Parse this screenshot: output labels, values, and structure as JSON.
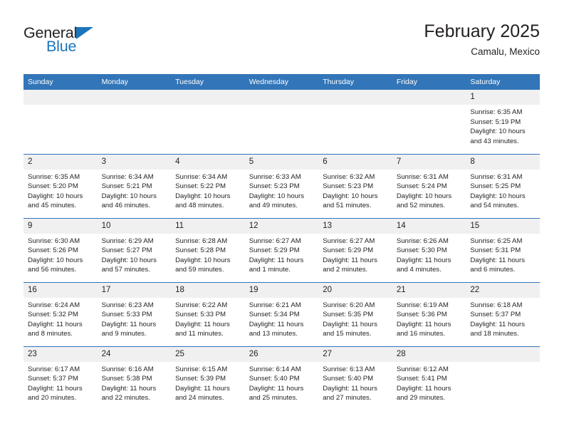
{
  "brand": {
    "name_part1": "General",
    "name_part2": "Blue",
    "triangle_icon": "triangle-icon",
    "accent_color": "#1b75bb"
  },
  "header": {
    "title": "February 2025",
    "subtitle": "Camalu, Mexico"
  },
  "colors": {
    "header_blue": "#3275b8",
    "daynum_band": "#f0f0f0",
    "text": "#231f20"
  },
  "weekday_headers": [
    "Sunday",
    "Monday",
    "Tuesday",
    "Wednesday",
    "Thursday",
    "Friday",
    "Saturday"
  ],
  "weeks": [
    [
      {
        "day": "",
        "empty": true
      },
      {
        "day": "",
        "empty": true
      },
      {
        "day": "",
        "empty": true
      },
      {
        "day": "",
        "empty": true
      },
      {
        "day": "",
        "empty": true
      },
      {
        "day": "",
        "empty": true
      },
      {
        "day": "1",
        "sunrise": "Sunrise: 6:35 AM",
        "sunset": "Sunset: 5:19 PM",
        "daylight": "Daylight: 10 hours and 43 minutes."
      }
    ],
    [
      {
        "day": "2",
        "sunrise": "Sunrise: 6:35 AM",
        "sunset": "Sunset: 5:20 PM",
        "daylight": "Daylight: 10 hours and 45 minutes."
      },
      {
        "day": "3",
        "sunrise": "Sunrise: 6:34 AM",
        "sunset": "Sunset: 5:21 PM",
        "daylight": "Daylight: 10 hours and 46 minutes."
      },
      {
        "day": "4",
        "sunrise": "Sunrise: 6:34 AM",
        "sunset": "Sunset: 5:22 PM",
        "daylight": "Daylight: 10 hours and 48 minutes."
      },
      {
        "day": "5",
        "sunrise": "Sunrise: 6:33 AM",
        "sunset": "Sunset: 5:23 PM",
        "daylight": "Daylight: 10 hours and 49 minutes."
      },
      {
        "day": "6",
        "sunrise": "Sunrise: 6:32 AM",
        "sunset": "Sunset: 5:23 PM",
        "daylight": "Daylight: 10 hours and 51 minutes."
      },
      {
        "day": "7",
        "sunrise": "Sunrise: 6:31 AM",
        "sunset": "Sunset: 5:24 PM",
        "daylight": "Daylight: 10 hours and 52 minutes."
      },
      {
        "day": "8",
        "sunrise": "Sunrise: 6:31 AM",
        "sunset": "Sunset: 5:25 PM",
        "daylight": "Daylight: 10 hours and 54 minutes."
      }
    ],
    [
      {
        "day": "9",
        "sunrise": "Sunrise: 6:30 AM",
        "sunset": "Sunset: 5:26 PM",
        "daylight": "Daylight: 10 hours and 56 minutes."
      },
      {
        "day": "10",
        "sunrise": "Sunrise: 6:29 AM",
        "sunset": "Sunset: 5:27 PM",
        "daylight": "Daylight: 10 hours and 57 minutes."
      },
      {
        "day": "11",
        "sunrise": "Sunrise: 6:28 AM",
        "sunset": "Sunset: 5:28 PM",
        "daylight": "Daylight: 10 hours and 59 minutes."
      },
      {
        "day": "12",
        "sunrise": "Sunrise: 6:27 AM",
        "sunset": "Sunset: 5:29 PM",
        "daylight": "Daylight: 11 hours and 1 minute."
      },
      {
        "day": "13",
        "sunrise": "Sunrise: 6:27 AM",
        "sunset": "Sunset: 5:29 PM",
        "daylight": "Daylight: 11 hours and 2 minutes."
      },
      {
        "day": "14",
        "sunrise": "Sunrise: 6:26 AM",
        "sunset": "Sunset: 5:30 PM",
        "daylight": "Daylight: 11 hours and 4 minutes."
      },
      {
        "day": "15",
        "sunrise": "Sunrise: 6:25 AM",
        "sunset": "Sunset: 5:31 PM",
        "daylight": "Daylight: 11 hours and 6 minutes."
      }
    ],
    [
      {
        "day": "16",
        "sunrise": "Sunrise: 6:24 AM",
        "sunset": "Sunset: 5:32 PM",
        "daylight": "Daylight: 11 hours and 8 minutes."
      },
      {
        "day": "17",
        "sunrise": "Sunrise: 6:23 AM",
        "sunset": "Sunset: 5:33 PM",
        "daylight": "Daylight: 11 hours and 9 minutes."
      },
      {
        "day": "18",
        "sunrise": "Sunrise: 6:22 AM",
        "sunset": "Sunset: 5:33 PM",
        "daylight": "Daylight: 11 hours and 11 minutes."
      },
      {
        "day": "19",
        "sunrise": "Sunrise: 6:21 AM",
        "sunset": "Sunset: 5:34 PM",
        "daylight": "Daylight: 11 hours and 13 minutes."
      },
      {
        "day": "20",
        "sunrise": "Sunrise: 6:20 AM",
        "sunset": "Sunset: 5:35 PM",
        "daylight": "Daylight: 11 hours and 15 minutes."
      },
      {
        "day": "21",
        "sunrise": "Sunrise: 6:19 AM",
        "sunset": "Sunset: 5:36 PM",
        "daylight": "Daylight: 11 hours and 16 minutes."
      },
      {
        "day": "22",
        "sunrise": "Sunrise: 6:18 AM",
        "sunset": "Sunset: 5:37 PM",
        "daylight": "Daylight: 11 hours and 18 minutes."
      }
    ],
    [
      {
        "day": "23",
        "sunrise": "Sunrise: 6:17 AM",
        "sunset": "Sunset: 5:37 PM",
        "daylight": "Daylight: 11 hours and 20 minutes."
      },
      {
        "day": "24",
        "sunrise": "Sunrise: 6:16 AM",
        "sunset": "Sunset: 5:38 PM",
        "daylight": "Daylight: 11 hours and 22 minutes."
      },
      {
        "day": "25",
        "sunrise": "Sunrise: 6:15 AM",
        "sunset": "Sunset: 5:39 PM",
        "daylight": "Daylight: 11 hours and 24 minutes."
      },
      {
        "day": "26",
        "sunrise": "Sunrise: 6:14 AM",
        "sunset": "Sunset: 5:40 PM",
        "daylight": "Daylight: 11 hours and 25 minutes."
      },
      {
        "day": "27",
        "sunrise": "Sunrise: 6:13 AM",
        "sunset": "Sunset: 5:40 PM",
        "daylight": "Daylight: 11 hours and 27 minutes."
      },
      {
        "day": "28",
        "sunrise": "Sunrise: 6:12 AM",
        "sunset": "Sunset: 5:41 PM",
        "daylight": "Daylight: 11 hours and 29 minutes."
      },
      {
        "day": "",
        "empty": true
      }
    ]
  ]
}
